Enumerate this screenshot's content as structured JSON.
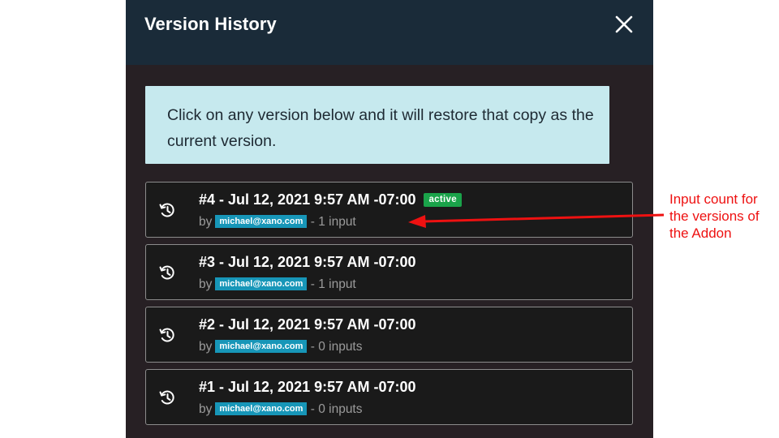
{
  "panel": {
    "title": "Version History",
    "close_label": "×"
  },
  "info": {
    "text": "Click on any version below and it will restore that copy as the current version."
  },
  "versions": [
    {
      "title": "#4 - Jul 12, 2021 9:57 AM -07:00",
      "badge": "active",
      "by": "by",
      "author": "michael@xano.com",
      "inputs": "- 1 input"
    },
    {
      "title": "#3 - Jul 12, 2021 9:57 AM -07:00",
      "badge": "",
      "by": "by",
      "author": "michael@xano.com",
      "inputs": "- 1 input"
    },
    {
      "title": "#2 - Jul 12, 2021 9:57 AM -07:00",
      "badge": "",
      "by": "by",
      "author": "michael@xano.com",
      "inputs": "- 0 inputs"
    },
    {
      "title": "#1 - Jul 12, 2021 9:57 AM -07:00",
      "badge": "",
      "by": "by",
      "author": "michael@xano.com",
      "inputs": "- 0 inputs"
    }
  ],
  "annotation": {
    "lines": [
      "Input count for",
      "the versions of",
      "the Addon"
    ]
  },
  "colors": {
    "header_bg": "#1a2b39",
    "panel_bg": "#272024",
    "info_bg": "#c6e9ee",
    "item_bg": "#1a1a1a",
    "active_badge": "#1aa34a",
    "author_chip": "#1796b8",
    "annotation": "#ee1111"
  },
  "icons": {
    "close": "close-icon",
    "history": "history-icon",
    "arrow": "arrow-left-icon"
  }
}
